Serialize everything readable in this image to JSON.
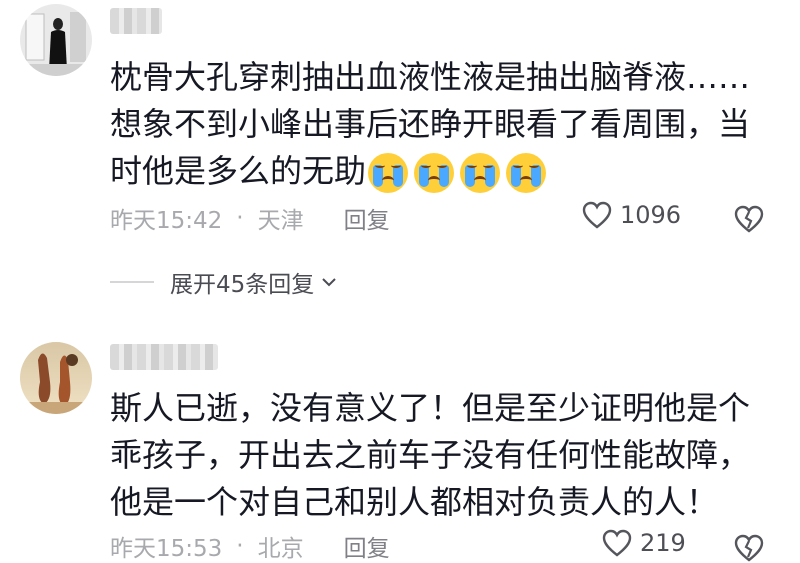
{
  "comments": [
    {
      "text": "枕骨大孔穿刺抽出血液性液是抽出脑脊液……想象不到小峰出事后还睁开眼看了看周围，当时他是多么的无助",
      "emoji": "crying-face-icon",
      "emoji_count": 4,
      "time": "昨天15:42",
      "location": "天津",
      "reply_label": "回复",
      "likes": "1096",
      "expand_label": "展开45条回复"
    },
    {
      "text": "斯人已逝，没有意义了！但是至少证明他是个乖孩子，开出去之前车子没有任何性能故障，他是一个对自己和别人都相对负责人的人！",
      "time": "昨天15:53",
      "location": "北京",
      "reply_label": "回复",
      "likes": "219"
    }
  ],
  "separator": "·",
  "colors": {
    "emoji_yellow": "#ffcf3a",
    "tear_blue": "#4aa8ff",
    "meta_gray": "#a8a9ad"
  }
}
